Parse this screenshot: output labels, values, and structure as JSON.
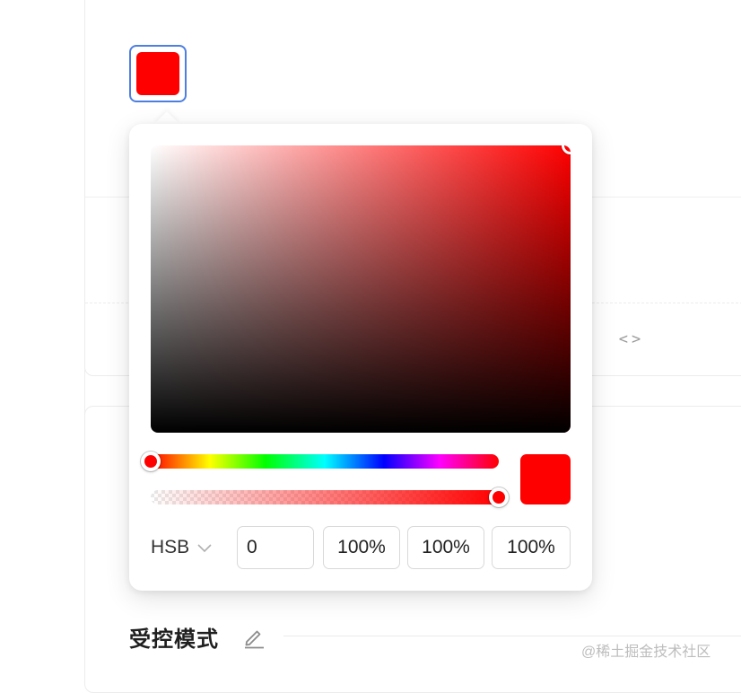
{
  "color": {
    "hex": "#ff0000",
    "hue": 0,
    "saturation": 1.0,
    "brightness": 1.0,
    "alpha": 1.0
  },
  "picker": {
    "mode_label": "HSB",
    "fields": {
      "hue": "0",
      "saturation": "100%",
      "brightness": "100%",
      "alpha": "100%"
    }
  },
  "icons": {
    "mode_dropdown": "chevron-down-icon",
    "code_toggle": "code-icon",
    "edit": "pencil-icon"
  },
  "background": {
    "section_title": "受控模式",
    "code_toggle_glyph_left": "<",
    "code_toggle_glyph_right": ">",
    "watermark": "@稀土掘金技术社区"
  }
}
